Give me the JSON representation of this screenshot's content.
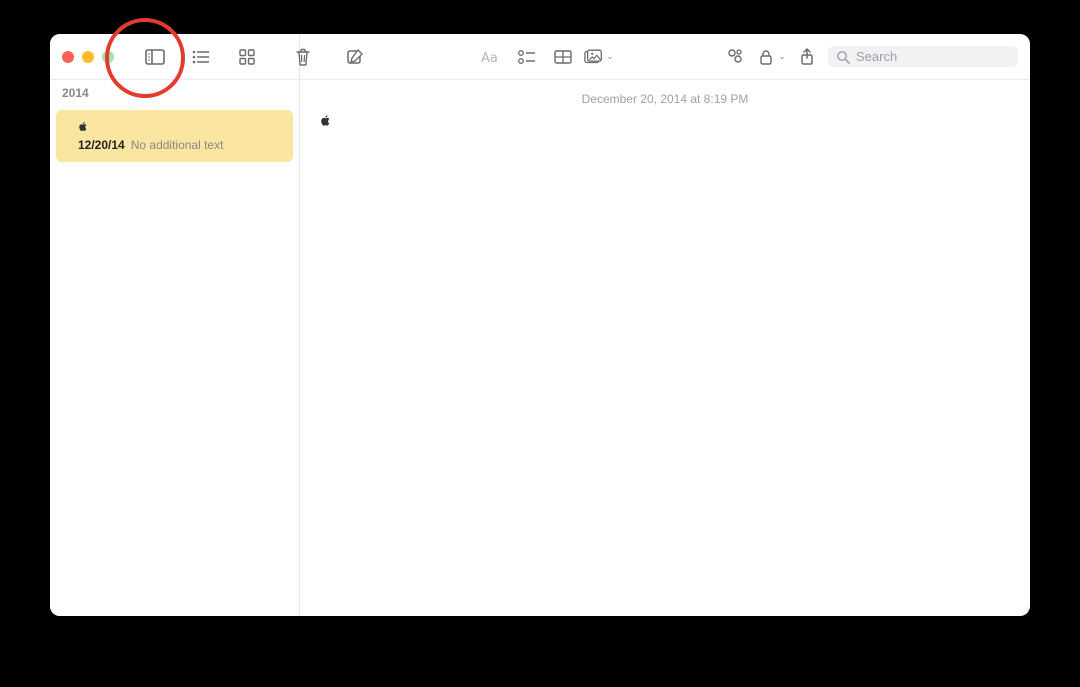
{
  "sidebar": {
    "section_label": "2014",
    "items": [
      {
        "title": "",
        "date": "12/20/14",
        "preview": "No additional text"
      }
    ]
  },
  "toolbar": {
    "search_placeholder": "Search"
  },
  "note": {
    "timestamp": "December 20, 2014 at 8:19 PM",
    "content": ""
  }
}
